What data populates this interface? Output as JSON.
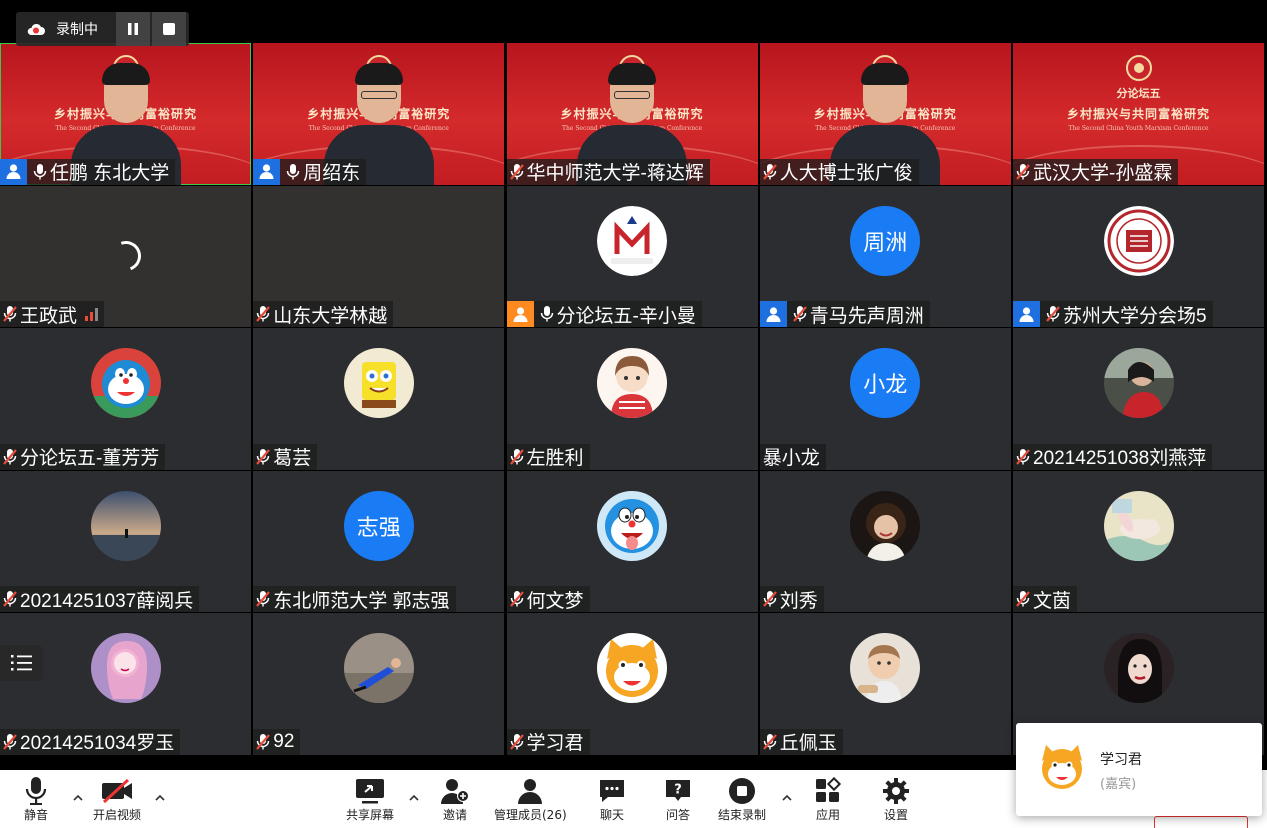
{
  "recording": {
    "label": "录制中"
  },
  "banner": {
    "title": "乡村振兴与共同富裕研究",
    "subtitle": "The Second China Youth Marxism Conference",
    "forum": "分论坛五"
  },
  "participants": [
    {
      "name": "任鹏 东北大学",
      "kind": "video",
      "user_icon": "blue",
      "mic": "on",
      "active": true
    },
    {
      "name": "周绍东",
      "kind": "video",
      "user_icon": "blue",
      "mic": "on"
    },
    {
      "name": "华中师范大学-蒋达辉",
      "kind": "video",
      "mic": "muted"
    },
    {
      "name": "人大博士张广俊",
      "kind": "video",
      "mic": "muted"
    },
    {
      "name": "武汉大学-孙盛霖",
      "kind": "banner",
      "mic": "muted"
    },
    {
      "name": "王政武",
      "kind": "loading",
      "mic": "muted",
      "signal": true
    },
    {
      "name": "山东大学林越",
      "kind": "dark",
      "mic": "muted"
    },
    {
      "name": "分论坛五-辛小曼",
      "kind": "avatar",
      "avatar": "qingma-logo",
      "user_icon": "orange",
      "mic": "on"
    },
    {
      "name": "青马先声周洲",
      "kind": "text-avatar",
      "avatar_text": "周洲",
      "user_icon": "blue",
      "mic": "muted"
    },
    {
      "name": "苏州大学分会场5",
      "kind": "avatar",
      "avatar": "soochow-seal",
      "user_icon": "blue",
      "mic": "muted"
    },
    {
      "name": "分论坛五-董芳芳",
      "kind": "avatar",
      "avatar": "doraemon",
      "mic": "muted"
    },
    {
      "name": "葛芸",
      "kind": "avatar",
      "avatar": "spongebob",
      "mic": "muted"
    },
    {
      "name": "左胜利",
      "kind": "avatar",
      "avatar": "girl-cartoon",
      "mic": "muted"
    },
    {
      "name": "暴小龙",
      "kind": "text-avatar",
      "avatar_text": "小龙",
      "mic": "none"
    },
    {
      "name": "2021425​1038刘燕萍",
      "kind": "avatar",
      "avatar": "girl-photo",
      "mic": "muted"
    },
    {
      "name": "20214251037薛阅兵",
      "kind": "avatar",
      "avatar": "sunset",
      "mic": "muted"
    },
    {
      "name": "东北师范大学 郭志强",
      "kind": "text-avatar",
      "avatar_text": "志强",
      "mic": "muted"
    },
    {
      "name": "何文梦",
      "kind": "avatar",
      "avatar": "doraemon-tongue",
      "mic": "muted"
    },
    {
      "name": "刘秀",
      "kind": "avatar",
      "avatar": "curly-girl",
      "mic": "muted"
    },
    {
      "name": "文茵",
      "kind": "avatar",
      "avatar": "rabbit-painting",
      "mic": "muted"
    },
    {
      "name": "20214251034罗玉",
      "kind": "avatar",
      "avatar": "pink-anime",
      "mic": "muted"
    },
    {
      "name": "92",
      "kind": "avatar",
      "avatar": "lying-person",
      "mic": "muted"
    },
    {
      "name": "学习君",
      "kind": "avatar",
      "avatar": "cat-mascot",
      "mic": "muted"
    },
    {
      "name": "丘佩玉",
      "kind": "avatar",
      "avatar": "baby",
      "mic": "muted"
    },
    {
      "name": "",
      "kind": "avatar",
      "avatar": "woman-portrait",
      "mic": "none"
    }
  ],
  "toolbar": {
    "mute": "静音",
    "video": "开启视频",
    "share": "共享屏幕",
    "invite": "邀请",
    "members": "管理成员(26)",
    "chat": "聊天",
    "qa": "问答",
    "end_record": "结束录制",
    "apps": "应用",
    "settings": "设置"
  },
  "popup": {
    "name": "学习君",
    "role": "(嘉宾)"
  },
  "colors": {
    "tile": "#2b2d31",
    "accent_blue": "#1a7cf5",
    "banner_red": "#c7252b",
    "mute_red": "#e74c3c"
  }
}
